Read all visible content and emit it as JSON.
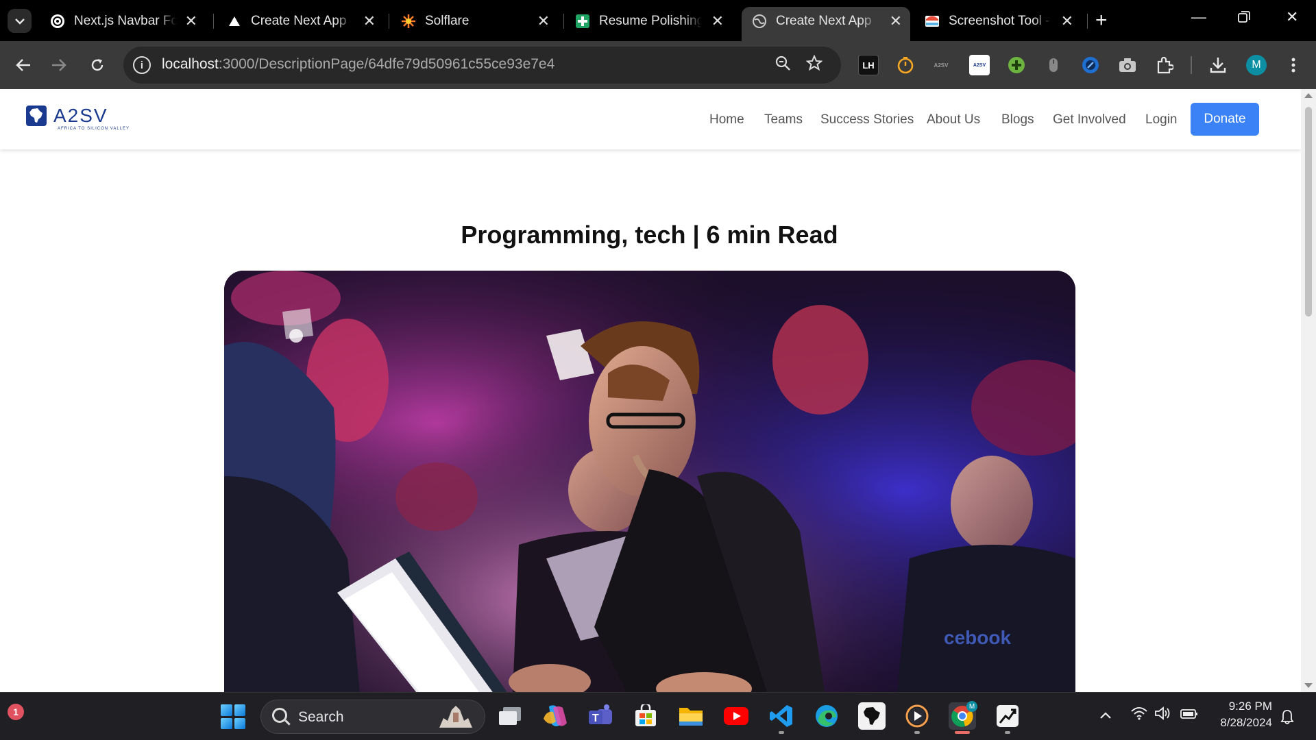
{
  "browser": {
    "tabs": [
      {
        "title": "Next.js Navbar Foo",
        "favicon": "chatgpt-icon",
        "active": false
      },
      {
        "title": "Create Next App",
        "favicon": "vercel-triangle-icon",
        "active": false
      },
      {
        "title": "Solflare",
        "favicon": "solflare-icon",
        "active": false
      },
      {
        "title": "Resume Polishing T",
        "favicon": "sheets-plus-icon",
        "active": false
      },
      {
        "title": "Create Next App",
        "favicon": "globe-icon",
        "active": true
      },
      {
        "title": "Screenshot Tool - S",
        "favicon": "screenshot-tool-icon",
        "active": false
      }
    ],
    "new_tab_label": "+",
    "url_host": "localhost",
    "url_rest": ":3000/DescriptionPage/64dfe79d50961c55ce93e7e4",
    "profile_initial": "M",
    "extensions": [
      "lighthouse-icon",
      "timer-icon",
      "a2sv-ext-icon",
      "a2sv-page-icon",
      "green-plus-icon",
      "mouse-icon",
      "blue-circle-icon",
      "camera-icon",
      "puzzle-icon"
    ],
    "ext_lh_label": "LH",
    "ext_a2sv_label": "A2SV"
  },
  "site": {
    "logo_text": "A2SV",
    "logo_tagline": "AFRICA TO SILICON VALLEY",
    "nav": [
      "Home",
      "Teams",
      "Success Stories",
      "About Us",
      "Blogs",
      "Get Involved",
      "Login"
    ],
    "donate_label": "Donate"
  },
  "article": {
    "meta": "Programming, tech | 6 min Read",
    "hero_alt": "hero-image"
  },
  "taskbar": {
    "notification_count": "1",
    "search_label": "Search",
    "time": "9:26 PM",
    "date": "8/28/2024",
    "apps": [
      "task-view-icon",
      "copilot-icon",
      "teams-icon",
      "store-icon",
      "file-explorer-icon",
      "youtube-icon",
      "vscode-icon",
      "edge-icon",
      "africa-app-icon",
      "media-player-icon",
      "chrome-icon",
      "stocks-app-icon"
    ],
    "chrome_badge": "M"
  },
  "colors": {
    "tabbar_bg": "#000000",
    "toolbar_bg": "#3a3a3a",
    "brand_blue": "#1a3a8f",
    "donate_blue": "#3b82f6",
    "taskbar_bg": "#1f1f24"
  }
}
